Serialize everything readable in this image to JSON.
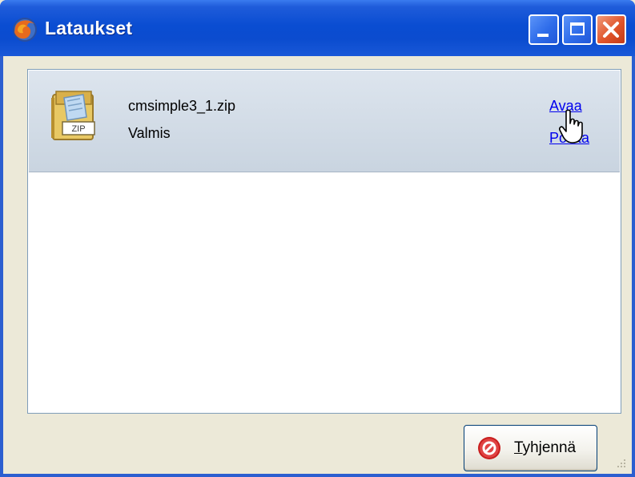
{
  "window": {
    "title": "Lataukset",
    "icon": "firefox-icon",
    "controls": [
      "minimize-icon",
      "maximize-icon",
      "close-icon"
    ]
  },
  "downloads": [
    {
      "filename": "cmsimple3_1.zip",
      "status": "Valmis",
      "icon": "zip-archive-icon",
      "actions": {
        "open": "Avaa",
        "remove": "Poista"
      }
    }
  ],
  "footer": {
    "clear_label": "Tyhjennä",
    "clear_icon": "clear-icon"
  },
  "colors": {
    "titlebar": "#0A4DD2",
    "window_bg": "#ECE9D8",
    "item_bg": "#C9D4E0",
    "link": "#0000EE",
    "close_button": "#E0542B"
  }
}
